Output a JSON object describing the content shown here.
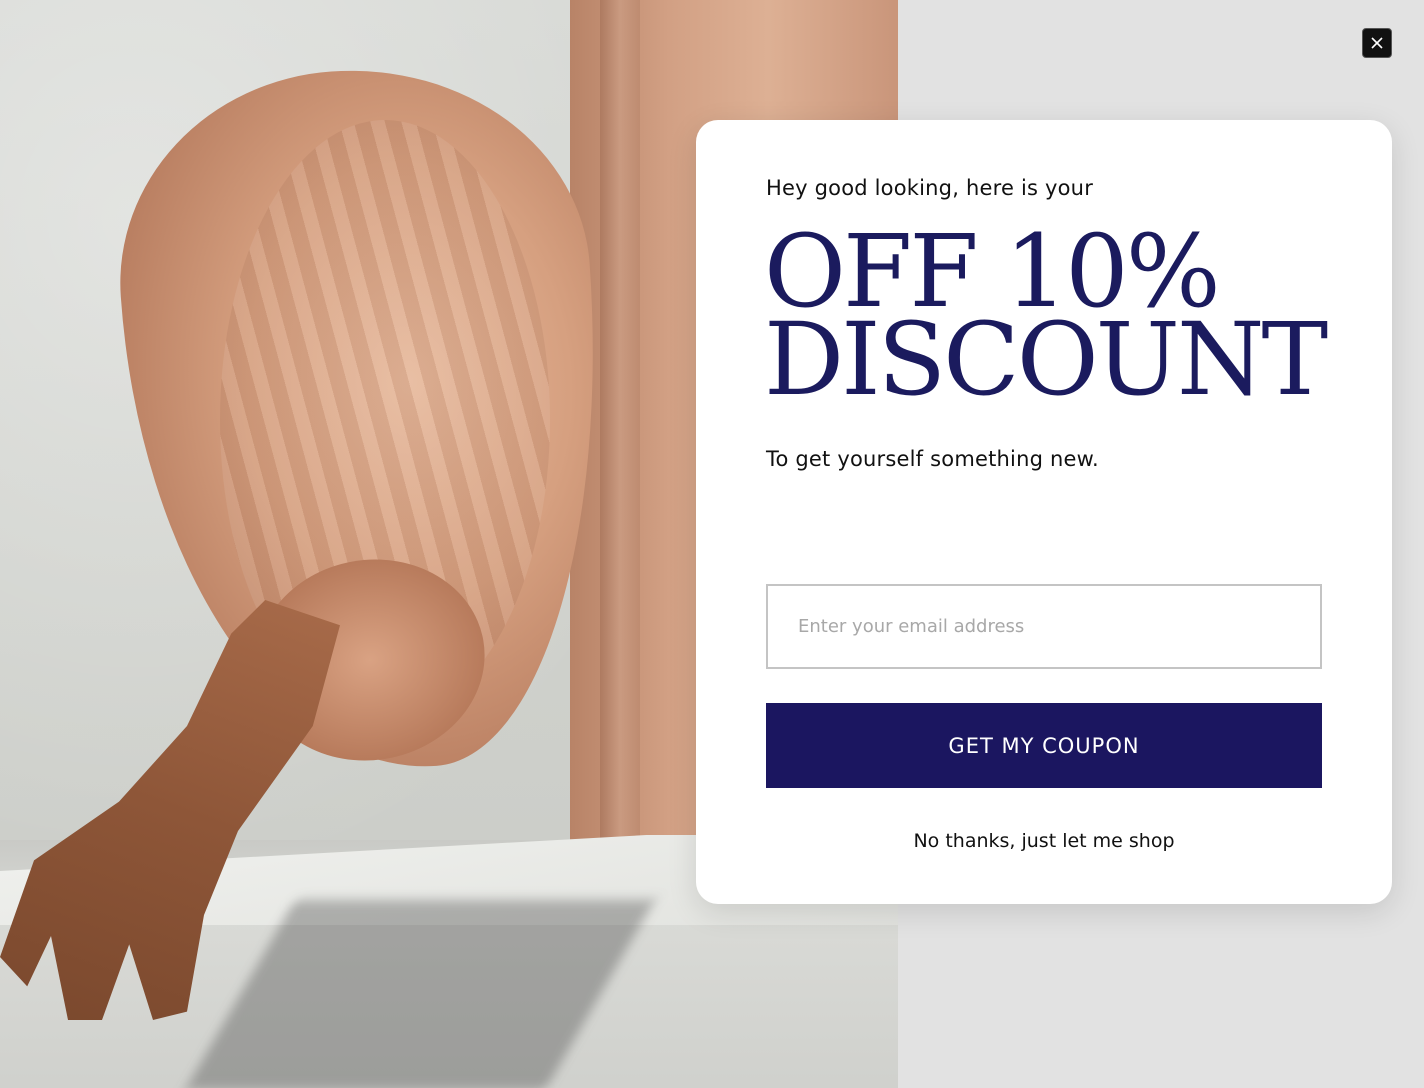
{
  "popup": {
    "eyebrow": "Hey good looking, here is your",
    "headline_line1": "OFF 10%",
    "headline_line2": "DISCOUNT",
    "subtext": "To get yourself something new.",
    "email_placeholder": "Enter your email address",
    "cta_label": "GET MY COUPON",
    "decline_label": "No thanks, just let me shop"
  },
  "colors": {
    "headline": "#1b1b5e",
    "cta_background": "#1b1660",
    "page_background": "#e2e2e2",
    "modal_background": "#ffffff"
  },
  "icons": {
    "close": "close-icon"
  }
}
